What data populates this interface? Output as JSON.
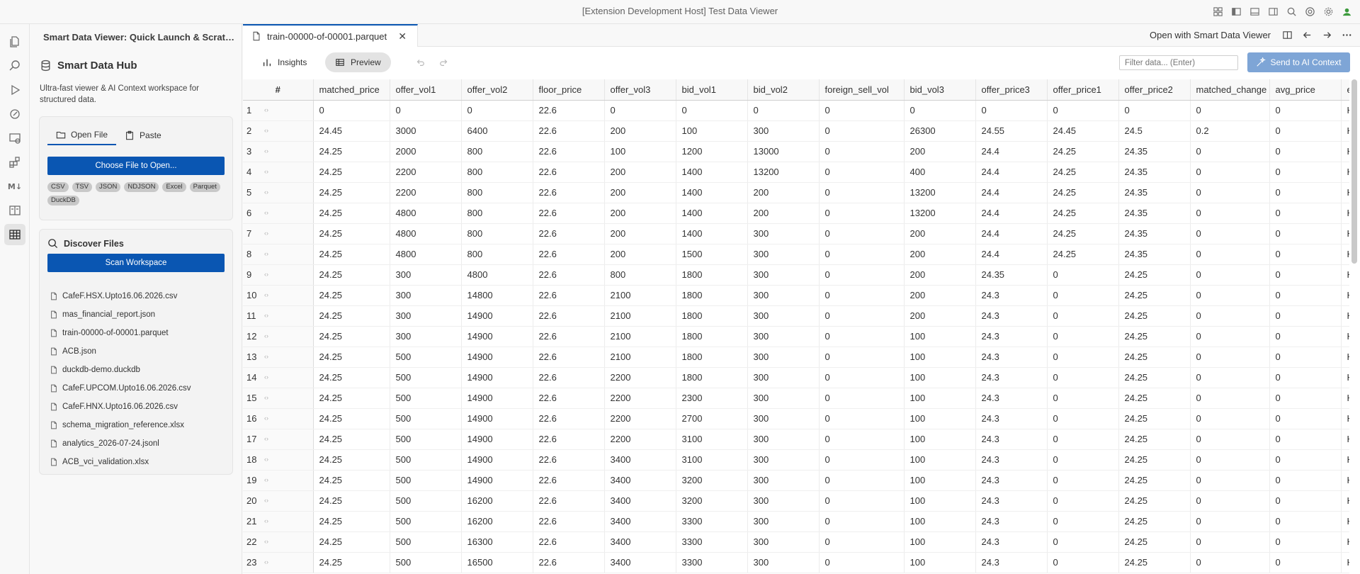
{
  "window": {
    "title": "[Extension Development Host] Test Data Viewer"
  },
  "sidebar": {
    "header": "Smart Data Viewer: Quick Launch & Scratch...",
    "hub_title": "Smart Data Hub",
    "hub_desc": "Ultra-fast viewer & AI Context workspace for structured data.",
    "tabs": [
      {
        "label": "Open File"
      },
      {
        "label": "Paste"
      }
    ],
    "choose_file_label": "Choose File to Open...",
    "formats": [
      "CSV",
      "TSV",
      "JSON",
      "NDJSON",
      "Excel",
      "Parquet",
      "DuckDB"
    ],
    "discover_title": "Discover Files",
    "scan_label": "Scan Workspace",
    "files": [
      "CafeF.HSX.Upto16.06.2026.csv",
      "mas_financial_report.json",
      "train-00000-of-00001.parquet",
      "ACB.json",
      "duckdb-demo.duckdb",
      "CafeF.UPCOM.Upto16.06.2026.csv",
      "CafeF.HNX.Upto16.06.2026.csv",
      "schema_migration_reference.xlsx",
      "analytics_2026-07-24.jsonl",
      "ACB_vci_validation.xlsx"
    ]
  },
  "editor": {
    "tab_label": "train-00000-of-00001.parquet",
    "open_with_label": "Open with Smart Data Viewer",
    "insights_label": "Insights",
    "preview_label": "Preview",
    "filter_placeholder": "Filter data... (Enter)",
    "send_label": "Send to AI Context"
  },
  "table": {
    "columns": [
      "matched_price",
      "offer_vol1",
      "offer_vol2",
      "floor_price",
      "offer_vol3",
      "bid_vol1",
      "bid_vol2",
      "foreign_sell_vol",
      "bid_vol3",
      "offer_price3",
      "offer_price1",
      "offer_price2",
      "matched_change",
      "avg_price",
      "excha"
    ],
    "rows": [
      [
        "0",
        "0",
        "0",
        "22.6",
        "0",
        "0",
        "0",
        "0",
        "0",
        "0",
        "0",
        "0",
        "0",
        "0",
        "HSX"
      ],
      [
        "24.45",
        "3000",
        "6400",
        "22.6",
        "200",
        "100",
        "300",
        "0",
        "26300",
        "24.55",
        "24.45",
        "24.5",
        "0.2",
        "0",
        "HSX"
      ],
      [
        "24.25",
        "2000",
        "800",
        "22.6",
        "100",
        "1200",
        "13000",
        "0",
        "200",
        "24.4",
        "24.25",
        "24.35",
        "0",
        "0",
        "HSX"
      ],
      [
        "24.25",
        "2200",
        "800",
        "22.6",
        "200",
        "1400",
        "13200",
        "0",
        "400",
        "24.4",
        "24.25",
        "24.35",
        "0",
        "0",
        "HSX"
      ],
      [
        "24.25",
        "2200",
        "800",
        "22.6",
        "200",
        "1400",
        "200",
        "0",
        "13200",
        "24.4",
        "24.25",
        "24.35",
        "0",
        "0",
        "HSX"
      ],
      [
        "24.25",
        "4800",
        "800",
        "22.6",
        "200",
        "1400",
        "200",
        "0",
        "13200",
        "24.4",
        "24.25",
        "24.35",
        "0",
        "0",
        "HSX"
      ],
      [
        "24.25",
        "4800",
        "800",
        "22.6",
        "200",
        "1400",
        "300",
        "0",
        "200",
        "24.4",
        "24.25",
        "24.35",
        "0",
        "0",
        "HSX"
      ],
      [
        "24.25",
        "4800",
        "800",
        "22.6",
        "200",
        "1500",
        "300",
        "0",
        "200",
        "24.4",
        "24.25",
        "24.35",
        "0",
        "0",
        "HSX"
      ],
      [
        "24.25",
        "300",
        "4800",
        "22.6",
        "800",
        "1800",
        "300",
        "0",
        "200",
        "24.35",
        "0",
        "24.25",
        "0",
        "0",
        "HSX"
      ],
      [
        "24.25",
        "300",
        "14800",
        "22.6",
        "2100",
        "1800",
        "300",
        "0",
        "200",
        "24.3",
        "0",
        "24.25",
        "0",
        "0",
        "HSX"
      ],
      [
        "24.25",
        "300",
        "14900",
        "22.6",
        "2100",
        "1800",
        "300",
        "0",
        "200",
        "24.3",
        "0",
        "24.25",
        "0",
        "0",
        "HSX"
      ],
      [
        "24.25",
        "300",
        "14900",
        "22.6",
        "2100",
        "1800",
        "300",
        "0",
        "100",
        "24.3",
        "0",
        "24.25",
        "0",
        "0",
        "HSX"
      ],
      [
        "24.25",
        "500",
        "14900",
        "22.6",
        "2100",
        "1800",
        "300",
        "0",
        "100",
        "24.3",
        "0",
        "24.25",
        "0",
        "0",
        "HSX"
      ],
      [
        "24.25",
        "500",
        "14900",
        "22.6",
        "2200",
        "1800",
        "300",
        "0",
        "100",
        "24.3",
        "0",
        "24.25",
        "0",
        "0",
        "HSX"
      ],
      [
        "24.25",
        "500",
        "14900",
        "22.6",
        "2200",
        "2300",
        "300",
        "0",
        "100",
        "24.3",
        "0",
        "24.25",
        "0",
        "0",
        "HSX"
      ],
      [
        "24.25",
        "500",
        "14900",
        "22.6",
        "2200",
        "2700",
        "300",
        "0",
        "100",
        "24.3",
        "0",
        "24.25",
        "0",
        "0",
        "HSX"
      ],
      [
        "24.25",
        "500",
        "14900",
        "22.6",
        "2200",
        "3100",
        "300",
        "0",
        "100",
        "24.3",
        "0",
        "24.25",
        "0",
        "0",
        "HSX"
      ],
      [
        "24.25",
        "500",
        "14900",
        "22.6",
        "3400",
        "3100",
        "300",
        "0",
        "100",
        "24.3",
        "0",
        "24.25",
        "0",
        "0",
        "HSX"
      ],
      [
        "24.25",
        "500",
        "14900",
        "22.6",
        "3400",
        "3200",
        "300",
        "0",
        "100",
        "24.3",
        "0",
        "24.25",
        "0",
        "0",
        "HSX"
      ],
      [
        "24.25",
        "500",
        "16200",
        "22.6",
        "3400",
        "3200",
        "300",
        "0",
        "100",
        "24.3",
        "0",
        "24.25",
        "0",
        "0",
        "HSX"
      ],
      [
        "24.25",
        "500",
        "16200",
        "22.6",
        "3400",
        "3300",
        "300",
        "0",
        "100",
        "24.3",
        "0",
        "24.25",
        "0",
        "0",
        "HSX"
      ],
      [
        "24.25",
        "500",
        "16300",
        "22.6",
        "3400",
        "3300",
        "300",
        "0",
        "100",
        "24.3",
        "0",
        "24.25",
        "0",
        "0",
        "HSX"
      ],
      [
        "24.25",
        "500",
        "16500",
        "22.6",
        "3400",
        "3300",
        "300",
        "0",
        "100",
        "24.3",
        "0",
        "24.25",
        "0",
        "0",
        "HSX"
      ]
    ]
  },
  "colors": {
    "accent": "#0a56b2",
    "send_button": "#7ea5d6"
  }
}
